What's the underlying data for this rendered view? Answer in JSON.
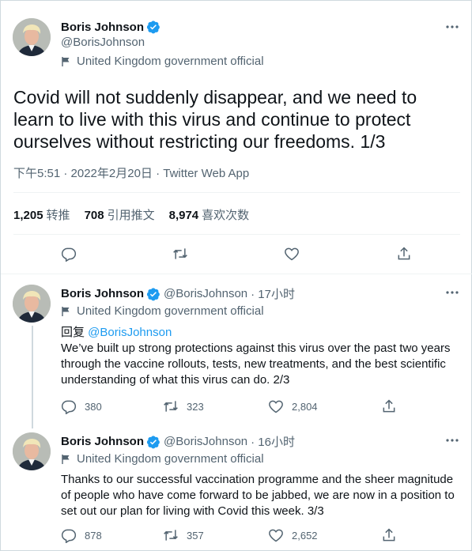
{
  "main_tweet": {
    "name": "Boris Johnson",
    "handle": "@BorisJohnson",
    "label": "United Kingdom government official",
    "text": "Covid will not suddenly disappear, and we need to learn to live with this virus and continue to protect ourselves without restricting our freedoms. 1/3",
    "timestamp": "下午5:51 · 2022年2月20日 · Twitter Web App",
    "stats": [
      {
        "value": "1,205",
        "label": "转推"
      },
      {
        "value": "708",
        "label": "引用推文"
      },
      {
        "value": "8,974",
        "label": "喜欢次数"
      }
    ]
  },
  "replies": [
    {
      "name": "Boris Johnson",
      "handle": "@BorisJohnson",
      "time": "· 17小时",
      "label": "United Kingdom government official",
      "replying_prefix": "回复 ",
      "replying_to": "@BorisJohnson",
      "text": "We’ve built up strong protections against this virus over the past two years through the vaccine rollouts, tests, new treatments, and the best scientific understanding of what this virus can do. 2/3",
      "replies": "380",
      "retweets": "323",
      "likes": "2,804"
    },
    {
      "name": "Boris Johnson",
      "handle": "@BorisJohnson",
      "time": "· 16小时",
      "label": "United Kingdom government official",
      "text": "Thanks to our successful vaccination programme and the sheer magnitude of people who have come forward to be jabbed, we are now in a position to set out our plan for living with Covid this week. 3/3",
      "replies": "878",
      "retweets": "357",
      "likes": "2,652"
    }
  ],
  "colors": {
    "verified": "#1d9bf0",
    "secondary_text": "#536471",
    "link": "#1d9bf0"
  }
}
